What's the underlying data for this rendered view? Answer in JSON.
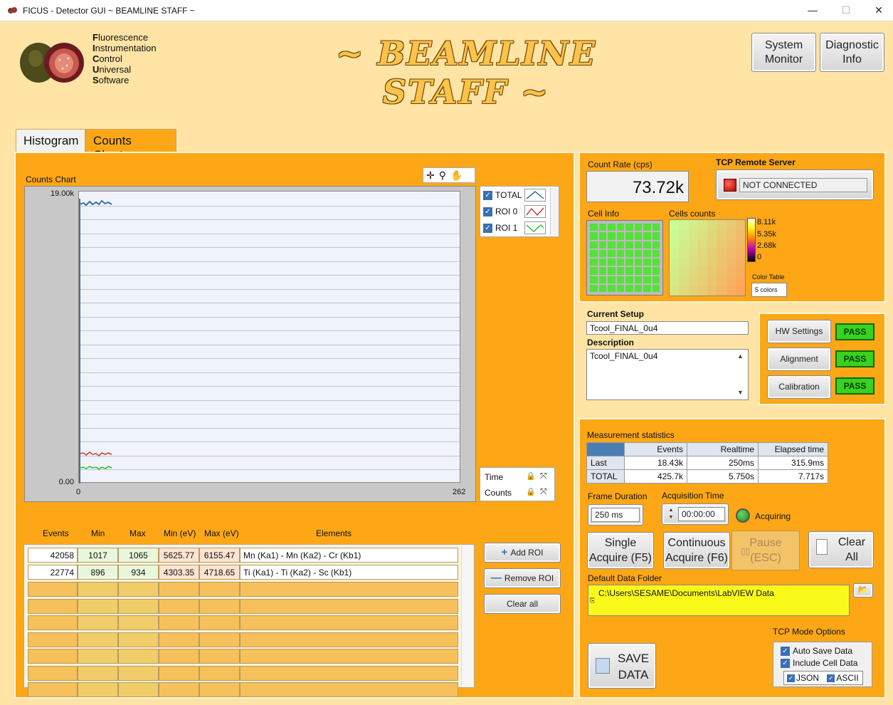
{
  "window": {
    "title": "FICUS - Detector GUI ~ BEAMLINE STAFF ~",
    "minimize": "—",
    "maximize": "☐",
    "close": "✕"
  },
  "logo": {
    "lines": [
      {
        "initial": "F",
        "rest": "luorescence"
      },
      {
        "initial": "I",
        "rest": "nstrumentation"
      },
      {
        "initial": "C",
        "rest": "ontrol"
      },
      {
        "initial": "U",
        "rest": "niversal"
      },
      {
        "initial": "S",
        "rest": "oftware"
      }
    ]
  },
  "banner": "~ BEAMLINE STAFF ~",
  "header_buttons": {
    "system_monitor": "System Monitor",
    "diagnostic_info": "Diagnostic Info"
  },
  "tabs": [
    {
      "label": "Histogram",
      "active": false
    },
    {
      "label": "Counts Charts",
      "active": true
    }
  ],
  "counts_chart": {
    "label": "Counts Chart",
    "y_top_tick": "19.00k",
    "y_bottom_tick": "0.00",
    "x_left_tick": "0",
    "x_right_tick": "262",
    "legend": [
      "TOTAL",
      "ROI 0",
      "ROI 1"
    ],
    "scale_labels": [
      "Time",
      "Counts"
    ]
  },
  "roi_table": {
    "headers": [
      "Events",
      "Min",
      "Max",
      "Min (eV)",
      "Max (eV)",
      "Elements"
    ],
    "rows": [
      [
        "42058",
        "1017",
        "1065",
        "5625.77",
        "6155.47",
        "Mn (Ka1) - Mn (Ka2) - Cr (Kb1)"
      ],
      [
        "22774",
        "896",
        "934",
        "4303.35",
        "4718.65",
        "Ti (Ka1) - Ti (Ka2) - Sc (Kb1)"
      ]
    ],
    "buttons": {
      "add": "Add ROI",
      "remove": "Remove ROI",
      "clear": "Clear all"
    }
  },
  "count_rate": {
    "label": "Count Rate (cps)",
    "value": "73.72k"
  },
  "tcp_server": {
    "label": "TCP Remote Server",
    "status": "NOT CONNECTED",
    "status_color": "#D40000"
  },
  "cell_info": {
    "label": "Cell Info"
  },
  "cells_counts": {
    "label": "Cells counts",
    "ticks": [
      "8.11k",
      "5.35k",
      "2.68k",
      "0"
    ],
    "color_table_label": "Color Table",
    "color_table_value": "5 colors"
  },
  "setup": {
    "current_label": "Current Setup",
    "current_value": "Tcool_FINAL_0u4",
    "description_label": "Description",
    "description_value": "Tcool_FINAL_0u4"
  },
  "hw_checks": [
    {
      "label": "HW Settings",
      "status": "PASS"
    },
    {
      "label": "Alignment",
      "status": "PASS"
    },
    {
      "label": "Calibration",
      "status": "PASS"
    }
  ],
  "stats": {
    "label": "Measurement statistics",
    "headers": [
      "",
      "Events",
      "Realtime",
      "Elapsed time"
    ],
    "rows": [
      [
        "Last",
        "18.43k",
        "250ms",
        "315.9ms"
      ],
      [
        "TOTAL",
        "425.7k",
        "5.750s",
        "7.717s"
      ]
    ]
  },
  "frame_duration": {
    "label": "Frame Duration",
    "value": "250 ms"
  },
  "acquisition_time": {
    "label": "Acquisition Time",
    "value": "00:00:00"
  },
  "acquiring": {
    "label": "Acquiring",
    "led_color": "#1f8a1f"
  },
  "acq_buttons": {
    "single": [
      "Single",
      "Acquire (F5)"
    ],
    "continuous": [
      "Continuous",
      "Acquire (F6)"
    ],
    "pause": [
      "Pause",
      "(ESC)"
    ],
    "clear": [
      "Clear",
      "All"
    ]
  },
  "data_folder": {
    "label": "Default Data Folder",
    "value": "C:\\Users\\SESAME\\Documents\\LabVIEW Data"
  },
  "save": {
    "line1": "SAVE",
    "line2": "DATA"
  },
  "tcp_mode": {
    "label": "TCP Mode Options",
    "auto_save": "Auto Save Data",
    "include_cell": "Include Cell Data",
    "json": "JSON",
    "ascii": "ASCII"
  }
}
